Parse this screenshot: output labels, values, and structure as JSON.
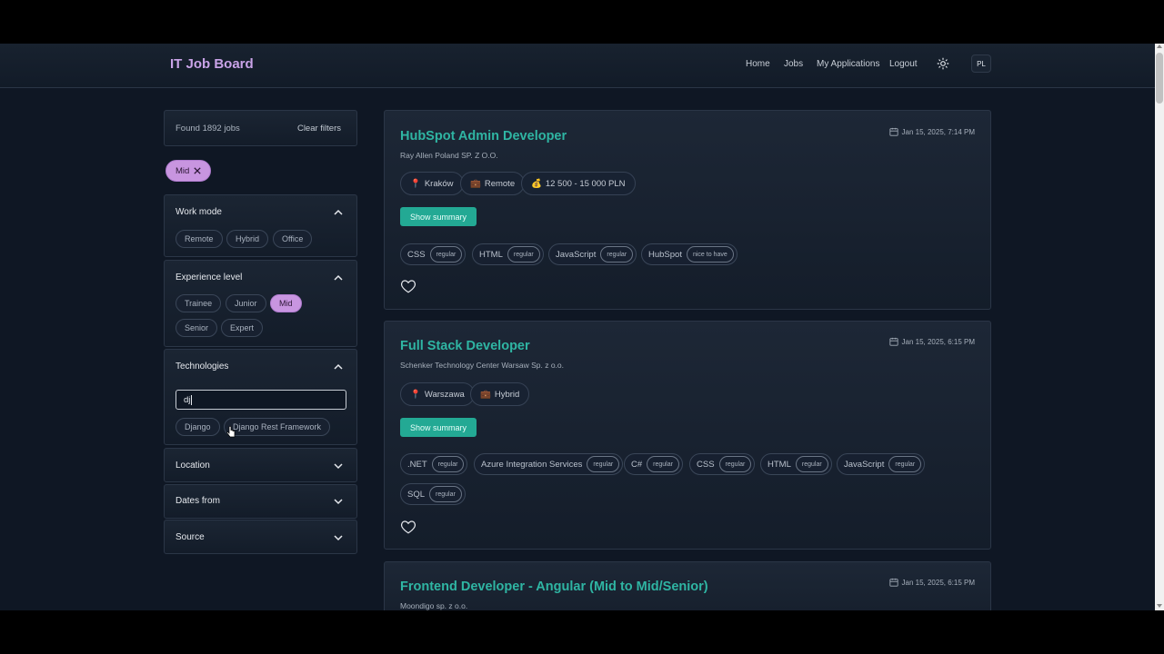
{
  "header": {
    "brand": "IT Job Board",
    "nav": [
      "Home",
      "Jobs",
      "My Applications",
      "Logout"
    ],
    "lang": "PL"
  },
  "filters": {
    "found": "Found 1892 jobs",
    "clear": "Clear filters",
    "active_chip": "Mid",
    "work_mode": {
      "title": "Work mode",
      "options": [
        "Remote",
        "Hybrid",
        "Office"
      ]
    },
    "experience": {
      "title": "Experience level",
      "options": [
        "Trainee",
        "Junior",
        "Mid",
        "Senior",
        "Expert"
      ],
      "selected": "Mid"
    },
    "technologies": {
      "title": "Technologies",
      "input_value": "dj",
      "suggestions": [
        "Django",
        "Django Rest Framework"
      ]
    },
    "location": {
      "title": "Location"
    },
    "dates": {
      "title": "Dates from"
    },
    "source": {
      "title": "Source"
    }
  },
  "jobs": [
    {
      "title": "HubSpot Admin Developer",
      "company": "Ray Allen Poland SP. Z O.O.",
      "date": "Jan 15, 2025, 7:14 PM",
      "meta": [
        {
          "icon": "📍",
          "text": "Kraków"
        },
        {
          "icon": "💼",
          "text": "Remote"
        },
        {
          "icon": "💰",
          "text": "12 500 - 15 000 PLN"
        }
      ],
      "summary_label": "Show summary",
      "techs": [
        {
          "name": "CSS",
          "level": "regular"
        },
        {
          "name": "HTML",
          "level": "regular"
        },
        {
          "name": "JavaScript",
          "level": "regular"
        },
        {
          "name": "HubSpot",
          "level": "nice to have"
        }
      ]
    },
    {
      "title": "Full Stack Developer",
      "company": "Schenker Technology Center Warsaw Sp. z o.o.",
      "date": "Jan 15, 2025, 6:15 PM",
      "meta": [
        {
          "icon": "📍",
          "text": "Warszawa"
        },
        {
          "icon": "💼",
          "text": "Hybrid"
        }
      ],
      "summary_label": "Show summary",
      "techs": [
        {
          "name": ".NET",
          "level": "regular"
        },
        {
          "name": "Azure Integration Services",
          "level": "regular"
        },
        {
          "name": "C#",
          "level": "regular"
        },
        {
          "name": "CSS",
          "level": "regular"
        },
        {
          "name": "HTML",
          "level": "regular"
        },
        {
          "name": "JavaScript",
          "level": "regular"
        },
        {
          "name": "SQL",
          "level": "regular"
        }
      ]
    },
    {
      "title": "Frontend Developer - Angular (Mid to Mid/Senior)",
      "company": "Moondigo sp. z o.o.",
      "date": "Jan 15, 2025, 6:15 PM"
    }
  ]
}
